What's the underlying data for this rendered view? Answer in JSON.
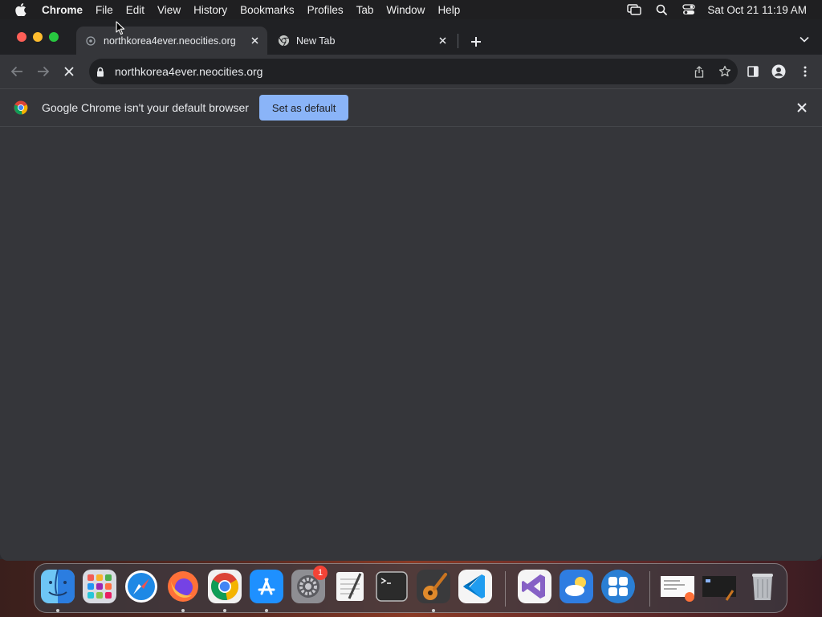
{
  "menubar": {
    "app_name": "Chrome",
    "items": [
      "File",
      "Edit",
      "View",
      "History",
      "Bookmarks",
      "Profiles",
      "Tab",
      "Window",
      "Help"
    ],
    "clock": "Sat Oct 21  11:19 AM"
  },
  "tabs": [
    {
      "title": "northkorea4ever.neocities.org",
      "active": true,
      "favicon": "globe-icon"
    },
    {
      "title": "New Tab",
      "active": false,
      "favicon": "chrome-icon"
    }
  ],
  "toolbar": {
    "url": "northkorea4ever.neocities.org",
    "loading": true
  },
  "infobar": {
    "message": "Google Chrome isn't your default browser",
    "button_label": "Set as default"
  },
  "dock": {
    "apps": [
      "Finder",
      "Launchpad",
      "Safari",
      "Firefox",
      "Google Chrome",
      "App Store",
      "System Settings",
      "TextEdit",
      "Terminal",
      "GarageBand",
      "Visual Studio Code",
      "Visual Studio",
      "Weather",
      "Mosaic"
    ],
    "settings_badge": "1"
  },
  "colors": {
    "accent_button": "#8ab4f8",
    "tabstrip": "#202124",
    "toolbar": "#35363a"
  }
}
